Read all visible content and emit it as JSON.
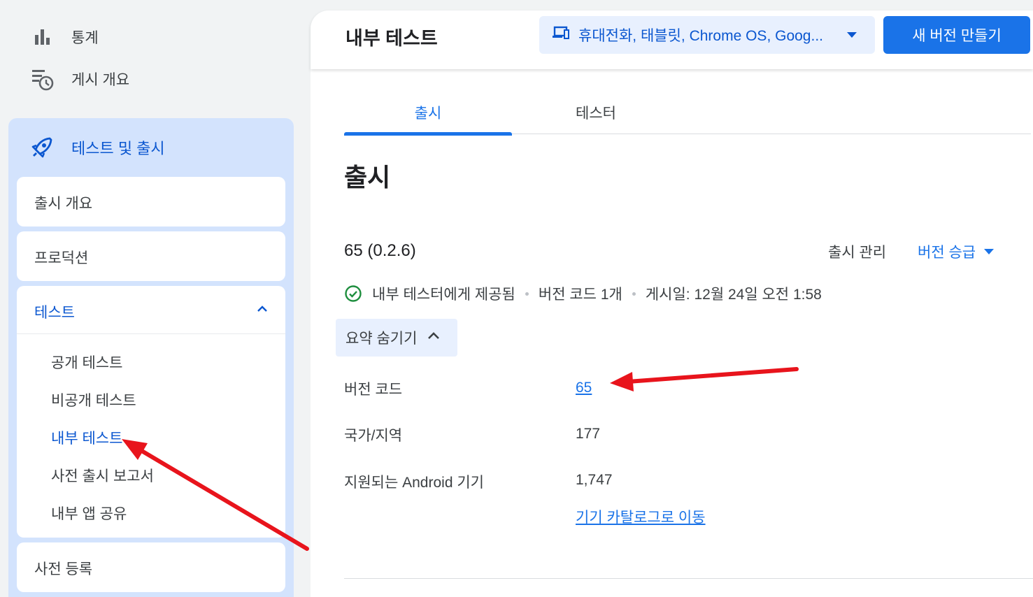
{
  "sidebar": {
    "top_items": [
      {
        "label": "통계",
        "icon": "bar-chart-icon"
      },
      {
        "label": "게시 개요",
        "icon": "publishing-overview-icon"
      }
    ],
    "section": {
      "label": "테스트 및 출시",
      "icon": "rocket-icon"
    },
    "cards": {
      "release_overview": "출시 개요",
      "production": "프로덕션",
      "testing": "테스트",
      "pre_registration": "사전 등록"
    },
    "testing_items": [
      {
        "label": "공개 테스트",
        "active": false
      },
      {
        "label": "비공개 테스트",
        "active": false
      },
      {
        "label": "내부 테스트",
        "active": true
      },
      {
        "label": "사전 출시 보고서",
        "active": false
      },
      {
        "label": "내부 앱 공유",
        "active": false
      }
    ]
  },
  "header": {
    "title": "내부 테스트",
    "device_filter": "휴대전화, 태블릿, Chrome OS, Goog...",
    "new_release_button": "새 버전 만들기"
  },
  "tabs": [
    {
      "label": "출시",
      "active": true
    },
    {
      "label": "테스터",
      "active": false
    }
  ],
  "section_title": "출시",
  "release": {
    "name": "65 (0.2.6)",
    "manage_label": "출시 관리",
    "promote_label": "버전 승급",
    "status": "내부 테스터에게 제공됨",
    "version_code_count": "버전 코드 1개",
    "published": "게시일: 12월 24일 오전 1:58",
    "summary_toggle": "요약 숨기기",
    "details": {
      "version_code_label": "버전 코드",
      "version_code_value": "65",
      "countries_label": "국가/지역",
      "countries_value": "177",
      "devices_label": "지원되는 Android 기기",
      "devices_value": "1,747",
      "catalog_link": "기기 카탈로그로 이동"
    }
  },
  "colors": {
    "accent": "#1a73e8",
    "selected_panel": "#d3e3fd",
    "success": "#1e8e3e",
    "annotation_arrow": "#e8141c"
  }
}
